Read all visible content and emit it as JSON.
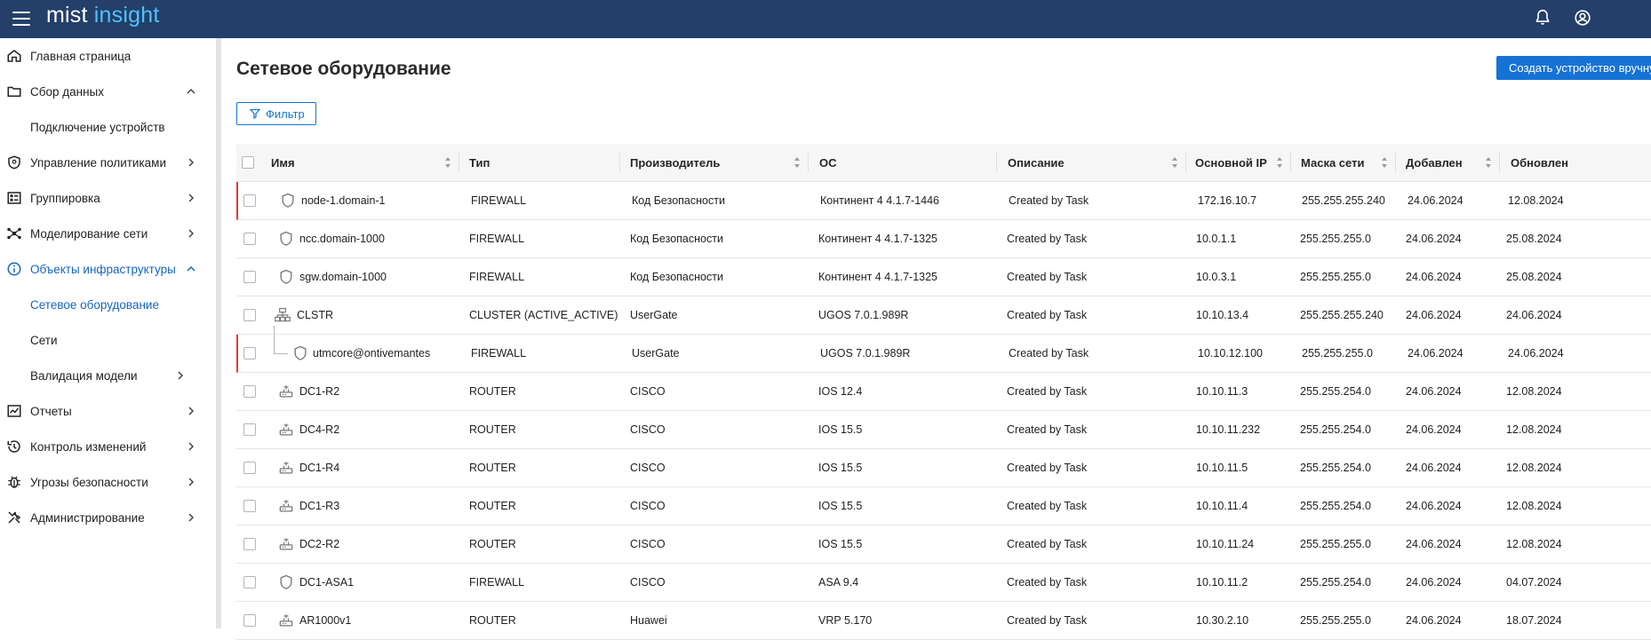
{
  "app": {
    "logo_word1": "mist",
    "logo_word2": "insight"
  },
  "colors": {
    "topbar": "#233f6a",
    "accent": "#1673d6",
    "active_nav": "#1565c0",
    "flag": "#e53935"
  },
  "sidebar": {
    "items": [
      {
        "label": "Главная страница",
        "icon": "home-icon",
        "chevron": ""
      },
      {
        "label": "Сбор данных",
        "icon": "folder-icon",
        "chevron": "up"
      },
      {
        "label": "Подключение устройств",
        "icon": "",
        "chevron": ""
      },
      {
        "label": "Управление политиками",
        "icon": "shield-icon",
        "chevron": "right"
      },
      {
        "label": "Группировка",
        "icon": "grouping-icon",
        "chevron": "right"
      },
      {
        "label": "Моделирование сети",
        "icon": "network-icon",
        "chevron": "right"
      },
      {
        "label": "Объекты инфраструктуры",
        "icon": "info-icon",
        "chevron": "up"
      },
      {
        "label": "Сетевое оборудование",
        "icon": "",
        "chevron": ""
      },
      {
        "label": "Сети",
        "icon": "",
        "chevron": ""
      },
      {
        "label": "Валидация модели",
        "icon": "",
        "chevron": "right"
      },
      {
        "label": "Отчеты",
        "icon": "report-icon",
        "chevron": "right"
      },
      {
        "label": "Контроль изменений",
        "icon": "history-icon",
        "chevron": "right"
      },
      {
        "label": "Угрозы безопасности",
        "icon": "bug-icon",
        "chevron": "right"
      },
      {
        "label": "Администрирование",
        "icon": "tools-icon",
        "chevron": "right"
      }
    ]
  },
  "main": {
    "title": "Сетевое оборудование",
    "create_button": "Создать устройство вручную",
    "filter_button": "Фильтр"
  },
  "table": {
    "columns": [
      "Имя",
      "Тип",
      "Производитель",
      "ОС",
      "Описание",
      "Основной IP",
      "Маска сети",
      "Добавлен",
      "Обновлен"
    ],
    "rows": [
      {
        "name": "node-1.domain-1",
        "icon": "shield-icon",
        "type": "FIREWALL",
        "vendor": "Код Безопасности",
        "os": "Континент 4 4.1.7-1446",
        "desc": "Created by Task",
        "ip": "172.16.10.7",
        "mask": "255.255.255.240",
        "added": "24.06.2024",
        "updated": "12.08.2024",
        "flag": true
      },
      {
        "name": "ncc.domain-1000",
        "icon": "shield-icon",
        "type": "FIREWALL",
        "vendor": "Код Безопасности",
        "os": "Континент 4 4.1.7-1325",
        "desc": "Created by Task",
        "ip": "10.0.1.1",
        "mask": "255.255.255.0",
        "added": "24.06.2024",
        "updated": "25.08.2024",
        "flag": false
      },
      {
        "name": "sgw.domain-1000",
        "icon": "shield-icon",
        "type": "FIREWALL",
        "vendor": "Код Безопасности",
        "os": "Континент 4 4.1.7-1325",
        "desc": "Created by Task",
        "ip": "10.0.3.1",
        "mask": "255.255.255.0",
        "added": "24.06.2024",
        "updated": "25.08.2024",
        "flag": false
      },
      {
        "name": "CLSTR",
        "icon": "cluster-icon",
        "type": "CLUSTER (ACTIVE_ACTIVE)",
        "vendor": "UserGate",
        "os": "UGOS 7.0.1.989R",
        "desc": "Created by Task",
        "ip": "10.10.13.4",
        "mask": "255.255.255.240",
        "added": "24.06.2024",
        "updated": "24.06.2024",
        "flag": false
      },
      {
        "name": "utmcore@ontivemantes",
        "icon": "shield-icon",
        "type": "FIREWALL",
        "vendor": "UserGate",
        "os": "UGOS 7.0.1.989R",
        "desc": "Created by Task",
        "ip": "10.10.12.100",
        "mask": "255.255.255.0",
        "added": "24.06.2024",
        "updated": "24.06.2024",
        "flag": true
      },
      {
        "name": "DC1-R2",
        "icon": "router-icon",
        "type": "ROUTER",
        "vendor": "CISCO",
        "os": "IOS 12.4",
        "desc": "Created by Task",
        "ip": "10.10.11.3",
        "mask": "255.255.254.0",
        "added": "24.06.2024",
        "updated": "12.08.2024",
        "flag": false
      },
      {
        "name": "DC4-R2",
        "icon": "router-icon",
        "type": "ROUTER",
        "vendor": "CISCO",
        "os": "IOS 15.5",
        "desc": "Created by Task",
        "ip": "10.10.11.232",
        "mask": "255.255.254.0",
        "added": "24.06.2024",
        "updated": "12.08.2024",
        "flag": false
      },
      {
        "name": "DC1-R4",
        "icon": "router-icon",
        "type": "ROUTER",
        "vendor": "CISCO",
        "os": "IOS 15.5",
        "desc": "Created by Task",
        "ip": "10.10.11.5",
        "mask": "255.255.254.0",
        "added": "24.06.2024",
        "updated": "12.08.2024",
        "flag": false
      },
      {
        "name": "DC1-R3",
        "icon": "router-icon",
        "type": "ROUTER",
        "vendor": "CISCO",
        "os": "IOS 15.5",
        "desc": "Created by Task",
        "ip": "10.10.11.4",
        "mask": "255.255.254.0",
        "added": "24.06.2024",
        "updated": "12.08.2024",
        "flag": false
      },
      {
        "name": "DC2-R2",
        "icon": "router-icon",
        "type": "ROUTER",
        "vendor": "CISCO",
        "os": "IOS 15.5",
        "desc": "Created by Task",
        "ip": "10.10.11.24",
        "mask": "255.255.255.0",
        "added": "24.06.2024",
        "updated": "12.08.2024",
        "flag": false
      },
      {
        "name": "DC1-ASA1",
        "icon": "shield-icon",
        "type": "FIREWALL",
        "vendor": "CISCO",
        "os": "ASA 9.4",
        "desc": "Created by Task",
        "ip": "10.10.11.2",
        "mask": "255.255.254.0",
        "added": "24.06.2024",
        "updated": "04.07.2024",
        "flag": false
      },
      {
        "name": "AR1000v1",
        "icon": "router-icon",
        "type": "ROUTER",
        "vendor": "Huawei",
        "os": "VRP 5.170",
        "desc": "Created by Task",
        "ip": "10.30.2.10",
        "mask": "255.255.255.0",
        "added": "24.06.2024",
        "updated": "18.07.2024",
        "flag": false
      }
    ]
  }
}
